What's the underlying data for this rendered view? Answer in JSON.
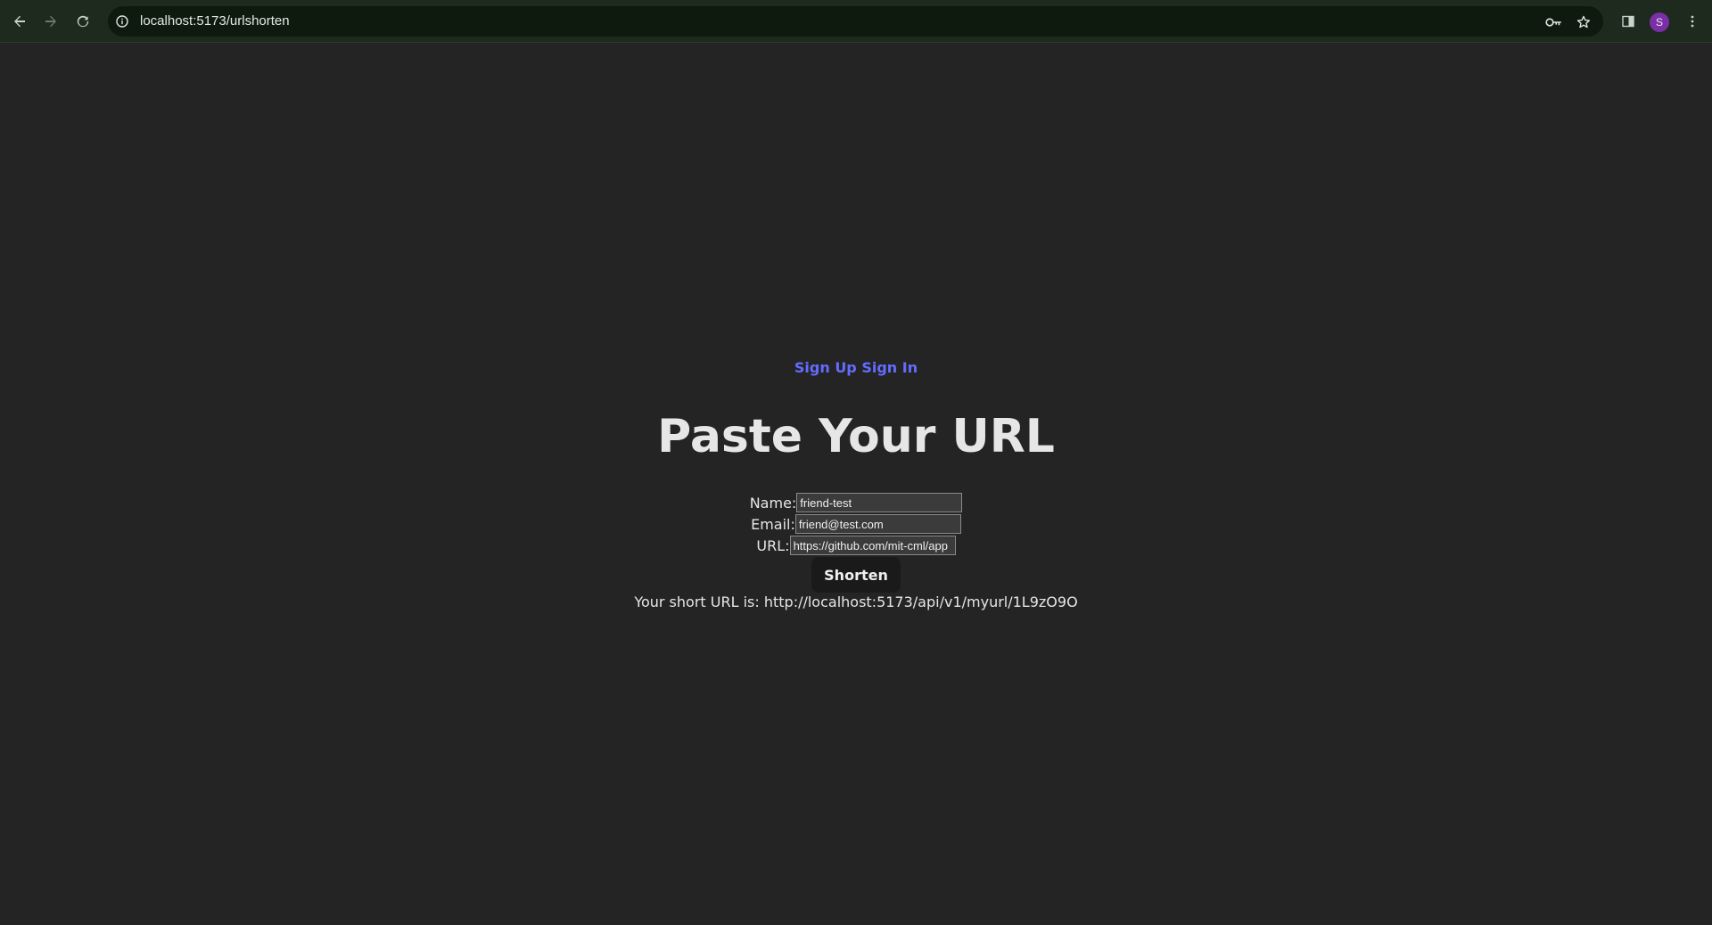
{
  "browser": {
    "address": "localhost:5173/urlshorten",
    "avatar_initial": "S",
    "colors": {
      "toolbar": "#1d2a1d",
      "omnibox": "#0f1a0f",
      "avatar": "#7b2fa6"
    }
  },
  "page": {
    "nav": {
      "sign_up": "Sign Up",
      "sign_in": "Sign In",
      "link_color": "#646cff"
    },
    "title": "Paste Your URL",
    "form": {
      "name_label": "Name:",
      "name_value": "friend-test",
      "email_label": "Email:",
      "email_value": "friend@test.com",
      "url_label": "URL:",
      "url_value": "https://github.com/mit-cml/app",
      "submit_label": "Shorten"
    },
    "result": {
      "text": "Your short URL is: http://localhost:5173/api/v1/myurl/1L9zO9O"
    },
    "background": "#242424"
  }
}
